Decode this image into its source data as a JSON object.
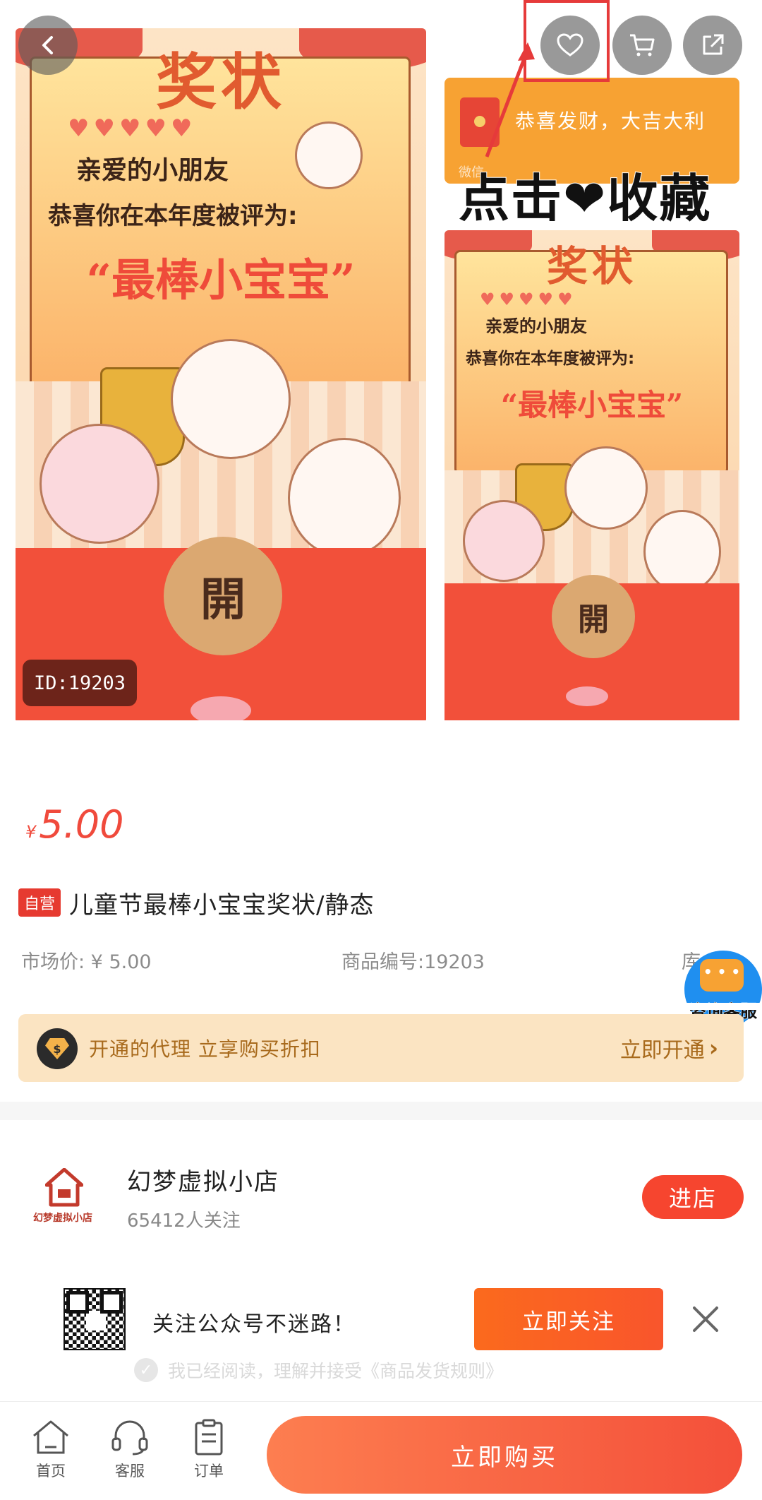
{
  "hero": {
    "id_badge": "ID:19203",
    "main_card": {
      "title": "奖状",
      "line1": "亲爱的小朋友",
      "line2": "恭喜你在本年度被评为:",
      "honor": "“最棒小宝宝”",
      "seal": "開"
    },
    "side_card": {
      "title": "奖状",
      "line1": "亲爱的小朋友",
      "line2": "恭喜你在本年度被评为:",
      "honor": "“最棒小宝宝”",
      "seal": "開"
    },
    "wx_banner": {
      "greeting": "恭喜发财，大吉大利",
      "label": "微信"
    },
    "fav_caption": {
      "before": "点击",
      "after": "收藏"
    }
  },
  "top_buttons": [
    {
      "name": "back",
      "icon": "chevron-left-icon"
    },
    {
      "name": "favorite",
      "icon": "heart-icon"
    },
    {
      "name": "cart",
      "icon": "cart-icon"
    },
    {
      "name": "share",
      "icon": "share-icon"
    }
  ],
  "product": {
    "currency": "¥",
    "price": "5.00",
    "self_tag": "自营",
    "title": "儿童节最棒小宝宝奖状/静态",
    "market_price": "市场价: ¥ 5.00",
    "product_code": "商品编号:19203",
    "stock_partial": "库"
  },
  "customer_service_float": {
    "label": "咨询客服",
    "color": "#1f8ff0"
  },
  "agent_bar": {
    "badge": "$",
    "promo": "开通的代理 立享购买折扣",
    "action": "立即开通"
  },
  "store": {
    "logo_text": "幻梦虚拟小店",
    "name": "幻梦虚拟小店",
    "followers": "65412人关注",
    "enter": "进店"
  },
  "follow_popup": {
    "text": "关注公众号不迷路！",
    "button": "立即关注"
  },
  "agreement": {
    "text": "我已经阅读，理解并接受《商品发货规则》"
  },
  "bottom_bar": {
    "tabs": [
      {
        "label": "首页",
        "icon": "home-icon"
      },
      {
        "label": "客服",
        "icon": "headset-icon"
      },
      {
        "label": "订单",
        "icon": "clipboard-icon"
      }
    ],
    "buy": "立即购买"
  },
  "colors": {
    "accent": "#f04a3c",
    "buy_gradient_start": "#fd7e50",
    "buy_gradient_end": "#f4503a",
    "agent_bg": "#fbe4c2",
    "agent_text": "#a86a1c"
  }
}
